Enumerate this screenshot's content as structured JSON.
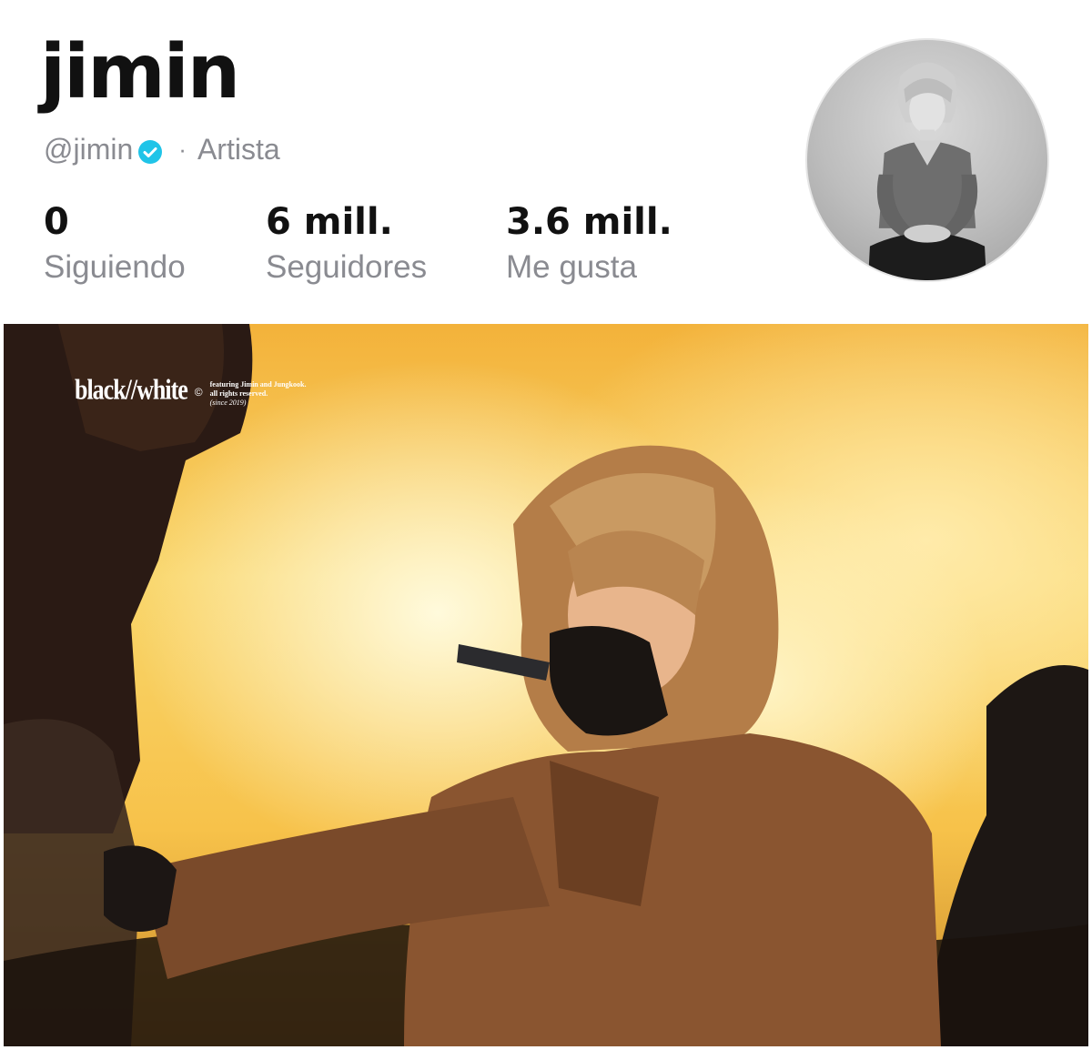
{
  "profile": {
    "display_name": "jimin",
    "handle": "@jimin",
    "separator": "·",
    "category": "Artista"
  },
  "stats": [
    {
      "value": "0",
      "label": "Siguiendo"
    },
    {
      "value": "6 mill.",
      "label": "Seguidores"
    },
    {
      "value": "3.6 mill.",
      "label": "Me gusta"
    }
  ],
  "icons": {
    "verified": "verified-check-icon"
  },
  "colors": {
    "verified_badge": "#20c4e8",
    "secondary_text": "#8a8b91",
    "primary_text": "#111111"
  },
  "photo": {
    "watermark_logo": "black//white",
    "watermark_copyright": "©",
    "watermark_line1": "featuring Jimin and Jungkook.",
    "watermark_line2": "all rights reserved.",
    "watermark_line3": "(since 2019)"
  }
}
